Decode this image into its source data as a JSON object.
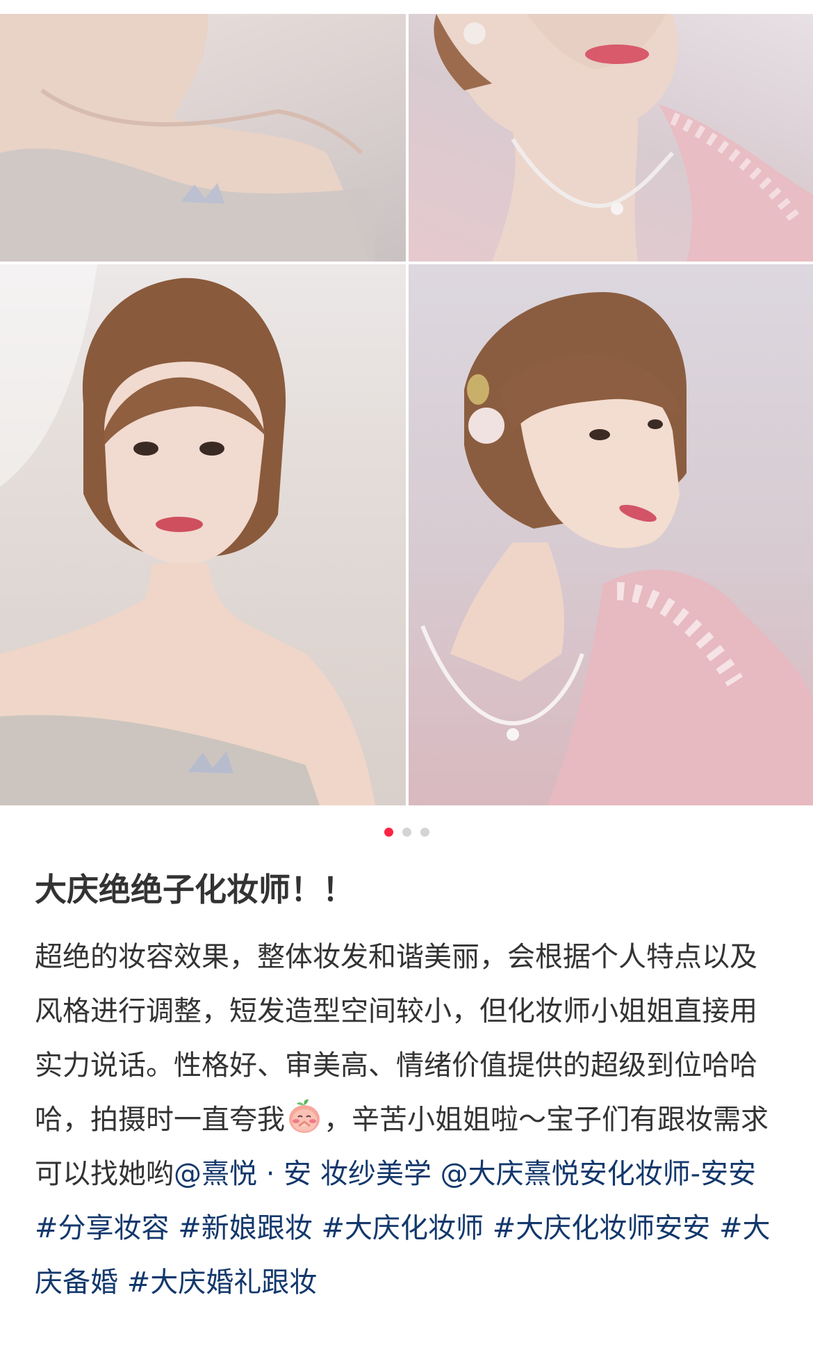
{
  "carousel": {
    "images": [
      {
        "name": "photo-shoulder-tulle-dress"
      },
      {
        "name": "photo-pink-sequin-dress-necklace"
      },
      {
        "name": "photo-front-updo-portrait"
      },
      {
        "name": "photo-side-profile-pearl-earring"
      }
    ],
    "page_count": 3,
    "current_page": 1
  },
  "note": {
    "title": "大庆绝绝子化妆师！！",
    "body_intro": "超绝的妆容效果，整体妆发和谐美丽，会根据个人特点以及风格进行调整，短发造型空间较小，但化妆师小姐姐直接用实力说话。性格好、审美高、情绪价值提供的超级到位哈哈哈，拍摄时一直夸我",
    "emoji": "peach-blush-emoji",
    "body_after_emoji": "，辛苦小姐姐啦～宝子们有跟妆需求可以找她哟",
    "mention_1": "@熹悦 · 安 妆纱美学",
    "mention_2": "@大庆熹悦安化妆师-安安",
    "tags": [
      "#分享妆容",
      "#新娘跟妆",
      "#大庆化妆师",
      "#大庆化妆师安安",
      "#大庆备婚",
      "#大庆婚礼跟妆"
    ]
  },
  "colors": {
    "accent_red": "#ff2442",
    "link_blue": "#13386c",
    "text": "#333333"
  }
}
